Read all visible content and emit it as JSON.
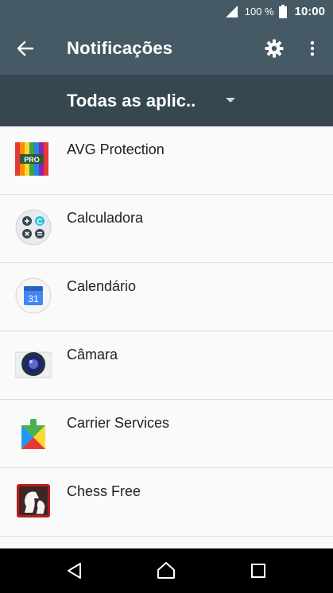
{
  "status": {
    "battery_percent": "100 %",
    "time": "10:00"
  },
  "app_bar": {
    "title": "Notificações"
  },
  "filter": {
    "selected": "Todas as aplic.."
  },
  "apps": [
    {
      "name": "AVG Protection",
      "icon": "avg-protection-icon"
    },
    {
      "name": "Calculadora",
      "icon": "calculator-icon"
    },
    {
      "name": "Calendário",
      "icon": "calendar-icon",
      "icon_text": "31"
    },
    {
      "name": "Câmara",
      "icon": "camera-icon"
    },
    {
      "name": "Carrier Services",
      "icon": "carrier-services-icon"
    },
    {
      "name": "Chess Free",
      "icon": "chess-icon"
    }
  ],
  "avg_badge_text": "PRO",
  "calculator_badge_text": "C",
  "colors": {
    "app_bar": "#455a64",
    "filter_bar": "#37474f",
    "background": "#fafafa",
    "nav_bar": "#000000"
  }
}
